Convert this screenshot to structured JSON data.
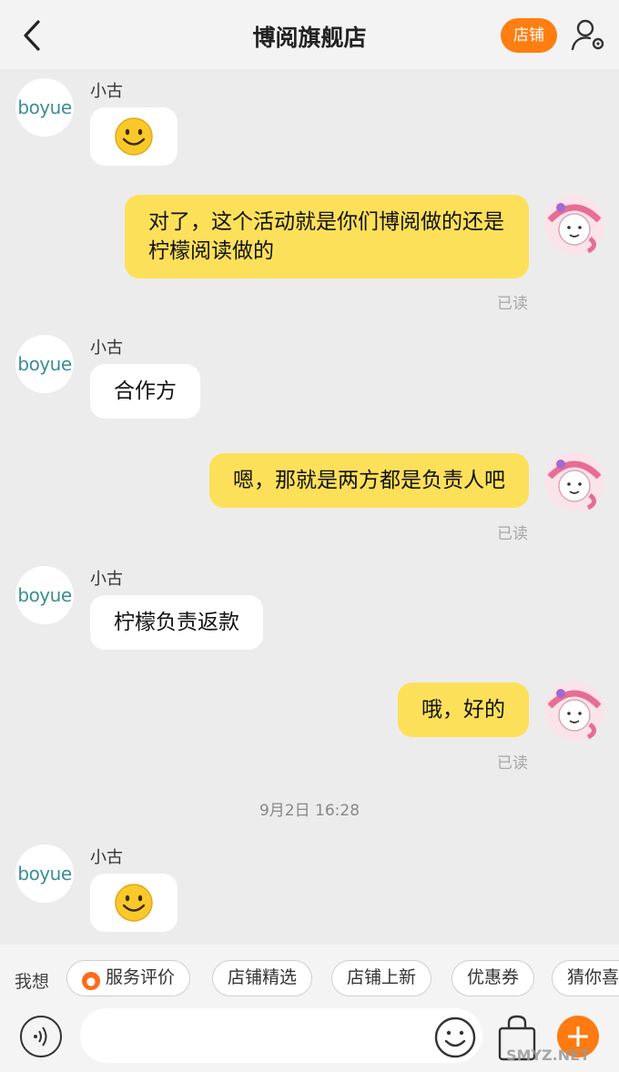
{
  "header": {
    "title": "博阅旗舰店",
    "shop_button": "店铺"
  },
  "store_avatar_text": "boyue",
  "messages": [
    {
      "side": "left",
      "sender": "小古",
      "type": "emoji",
      "emoji": "smile"
    },
    {
      "side": "right",
      "text": "对了，这个活动就是你们博阅做的还是柠檬阅读做的",
      "status": "已读"
    },
    {
      "side": "left",
      "sender": "小古",
      "text": "合作方"
    },
    {
      "side": "right",
      "text": "嗯，那就是两方都是负责人吧",
      "status": "已读"
    },
    {
      "side": "left",
      "sender": "小古",
      "text": "柠檬负责返款"
    },
    {
      "side": "right",
      "text": "哦，好的",
      "status": "已读"
    },
    {
      "type": "timestamp",
      "text": "9月2日 16:28"
    },
    {
      "side": "left",
      "sender": "小古",
      "type": "emoji",
      "emoji": "smile"
    }
  ],
  "quick_bar": {
    "label": "我想",
    "chips": [
      "服务评价",
      "店铺精选",
      "店铺上新",
      "优惠券",
      "猜你喜"
    ]
  },
  "input": {
    "placeholder": ""
  },
  "watermark": "SMYZ.NET",
  "colors": {
    "accent": "#ff7e12",
    "my_bubble": "#fde05a",
    "their_bubble": "#ffffff",
    "store_avatar_text": "#3b8e96"
  }
}
